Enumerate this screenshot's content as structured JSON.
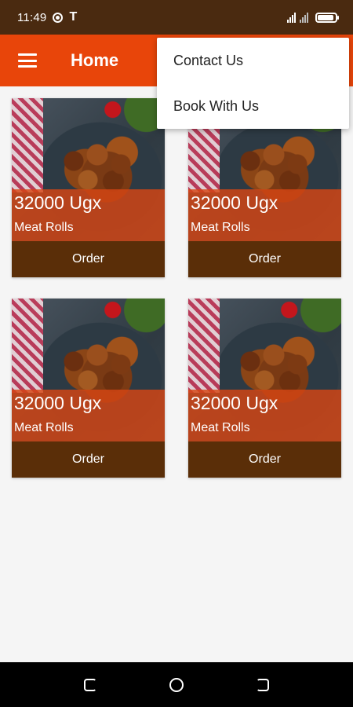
{
  "status_bar": {
    "time": "11:49",
    "t_icon": "T"
  },
  "app_bar": {
    "title": "Home",
    "menu_icon": "hamburger-menu-icon"
  },
  "overflow_menu": {
    "items": [
      {
        "label": "Contact Us"
      },
      {
        "label": "Book With Us"
      }
    ]
  },
  "products": [
    {
      "price": "32000 Ugx",
      "name": "Meat Rolls",
      "button": "Order"
    },
    {
      "price": "32000 Ugx",
      "name": "Meat Rolls",
      "button": "Order"
    },
    {
      "price": "32000 Ugx",
      "name": "Meat Rolls",
      "button": "Order"
    },
    {
      "price": "32000 Ugx",
      "name": "Meat Rolls",
      "button": "Order"
    }
  ],
  "colors": {
    "status_bar": "#4a2a10",
    "app_bar": "#e8450a",
    "order_button": "#5a2e08",
    "price_overlay": "#d64614"
  }
}
